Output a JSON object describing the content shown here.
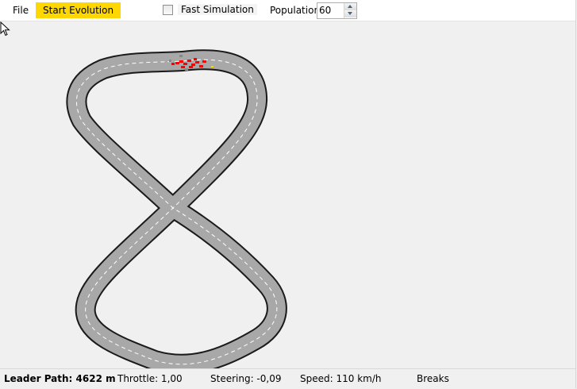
{
  "menu": {
    "file_label": "File",
    "start_label": "Start Evolution"
  },
  "toolbar": {
    "fast_simulation_label": "Fast Simulation",
    "fast_simulation_checked": false,
    "population_label": "Population",
    "population_value": "60"
  },
  "status": {
    "leader_path": "Leader Path: 4622 m",
    "throttle": "Throttle: 1,00",
    "steering": "Steering: -0,09",
    "speed": "Speed: 110 km/h",
    "breaks": "Breaks"
  },
  "colors": {
    "accent": "#ffd700",
    "track": "#a8a8a8",
    "track_edge": "#1a1a1a",
    "lane": "#ffffff",
    "car": "#ff0000"
  },
  "icons": {
    "cursor": "mouse-pointer-icon"
  }
}
